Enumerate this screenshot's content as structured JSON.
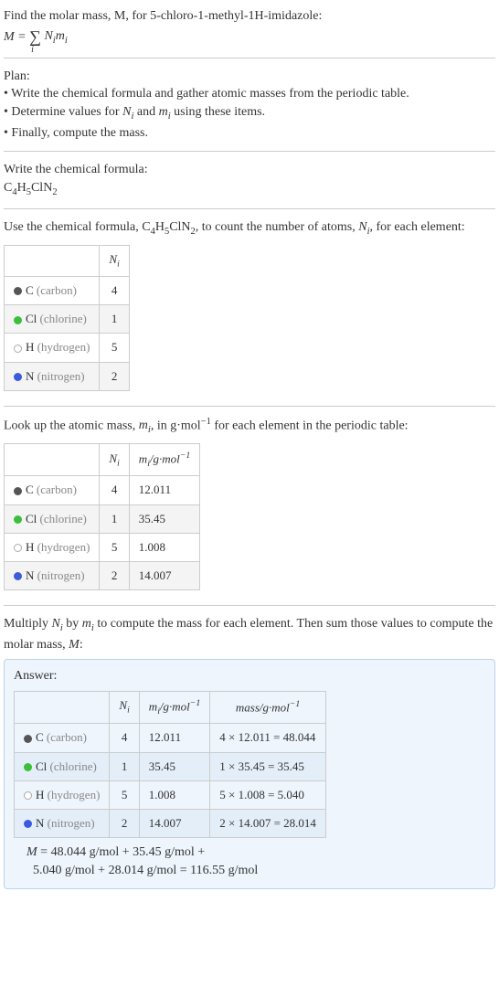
{
  "intro": {
    "line1": "Find the molar mass, M, for 5-chloro-1-methyl-1H-imidazole:",
    "eq_left": "M = ",
    "eq_sigma": "∑",
    "eq_idx": "i",
    "eq_right_html": "N<sub>i</sub>m<sub>i</sub>"
  },
  "plan": {
    "title": "Plan:",
    "items": [
      "Write the chemical formula and gather atomic masses from the periodic table.",
      "Determine values for N_i and m_i using these items.",
      "Finally, compute the mass."
    ],
    "item2_html": "Determine values for <span class=\"ital\">N<sub>i</sub></span> and <span class=\"ital\">m<sub>i</sub></span> using these items."
  },
  "writeFormula": {
    "label": "Write the chemical formula:",
    "formula_html": "C<sub>4</sub>H<sub>5</sub>ClN<sub>2</sub>"
  },
  "useFormula": {
    "text_html": "Use the chemical formula, C<sub>4</sub>H<sub>5</sub>ClN<sub>2</sub>, to count the number of atoms, <span class=\"ital\">N<sub>i</sub></span>, for each element:"
  },
  "elements": [
    {
      "dot": "dot-c",
      "sym": "C",
      "name": "(carbon)",
      "N": "4",
      "m": "12.011",
      "mass": "4 × 12.011 = 48.044"
    },
    {
      "dot": "dot-cl",
      "sym": "Cl",
      "name": "(chlorine)",
      "N": "1",
      "m": "35.45",
      "mass": "1 × 35.45 = 35.45"
    },
    {
      "dot": "dot-h",
      "sym": "H",
      "name": "(hydrogen)",
      "N": "5",
      "m": "1.008",
      "mass": "5 × 1.008 = 5.040"
    },
    {
      "dot": "dot-n",
      "sym": "N",
      "name": "(nitrogen)",
      "N": "2",
      "m": "14.007",
      "mass": "2 × 14.007 = 28.014"
    }
  ],
  "headers": {
    "Ni_html": "N<sub>i</sub>",
    "mi_html": "m<sub>i</sub>/g·mol<sup>−1</sup>",
    "mass_html": "mass/g·mol<sup>−1</sup>"
  },
  "lookup": {
    "text_html": "Look up the atomic mass, <span class=\"ital\">m<sub>i</sub></span>, in g·mol<sup>−1</sup> for each element in the periodic table:"
  },
  "multiply": {
    "text_html": "Multiply <span class=\"ital\">N<sub>i</sub></span> by <span class=\"ital\">m<sub>i</sub></span> to compute the mass for each element. Then sum those values to compute the molar mass, <span class=\"ital\">M</span>:"
  },
  "answer": {
    "label": "Answer:",
    "final_line1": "M = 48.044 g/mol + 35.45 g/mol +",
    "final_line2": "5.040 g/mol + 28.014 g/mol = 116.55 g/mol"
  }
}
